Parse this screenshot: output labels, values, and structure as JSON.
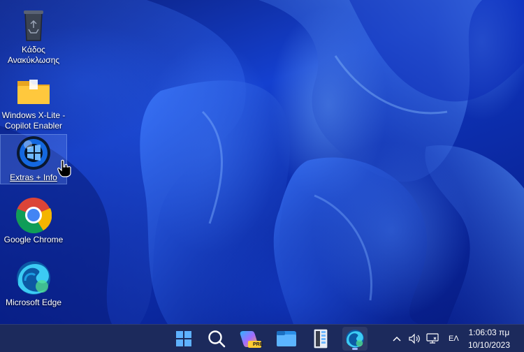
{
  "desktop": {
    "icons": [
      {
        "label": "Κάδος Ανακύκλωσης",
        "icon": "recycle-bin-icon"
      },
      {
        "label": "Windows X-Lite - Copilot Enabler",
        "icon": "folder-icon"
      },
      {
        "label": "Extras + Info",
        "icon": "windows-x-lite-icon"
      },
      {
        "label": "Google Chrome",
        "icon": "chrome-icon"
      },
      {
        "label": "Microsoft Edge",
        "icon": "edge-icon"
      }
    ]
  },
  "taskbar": {
    "apps": [
      "start-icon",
      "search-icon",
      "copilot-icon",
      "file-explorer-icon",
      "control-panel-icon",
      "edge-icon"
    ],
    "copilot_badge": "PRE",
    "tray": {
      "language": "ΕΛ",
      "time": "1:06:03 πμ",
      "date": "10/10/2023"
    }
  },
  "colors": {
    "taskbar": "#1c2a5c",
    "wallpaper_primary": "#1440d0",
    "accent": "#9fb6ff"
  }
}
